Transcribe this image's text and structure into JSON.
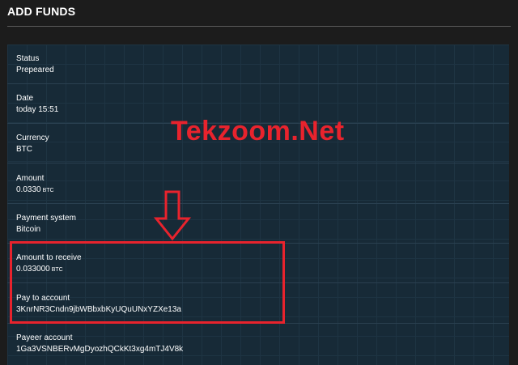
{
  "header": {
    "title": "ADD FUNDS"
  },
  "details": [
    {
      "label": "Status",
      "value": "Prepeared",
      "unit": ""
    },
    {
      "label": "Date",
      "value": "today 15:51",
      "unit": ""
    },
    {
      "label": "Currency",
      "value": "BTC",
      "unit": ""
    },
    {
      "label": "Amount",
      "value": "0.0330",
      "unit": "BTC"
    },
    {
      "label": "Payment system",
      "value": "Bitcoin",
      "unit": ""
    },
    {
      "label": "Amount to receive",
      "value": "0.033000",
      "unit": "BTC"
    },
    {
      "label": "Pay to account",
      "value": "3KnrNR3Cndn9jbWBbxbKyUQuUNxYZXe13a",
      "unit": ""
    },
    {
      "label": "Payeer account",
      "value": "1Ga3VSNBERvMgDyozhQCkKt3xg4mTJ4V8k",
      "unit": ""
    }
  ],
  "overlay": {
    "watermark": "Tekzoom.Net",
    "accent_color": "#e8232d",
    "arrow_icon": "arrow-down-outline-icon"
  }
}
